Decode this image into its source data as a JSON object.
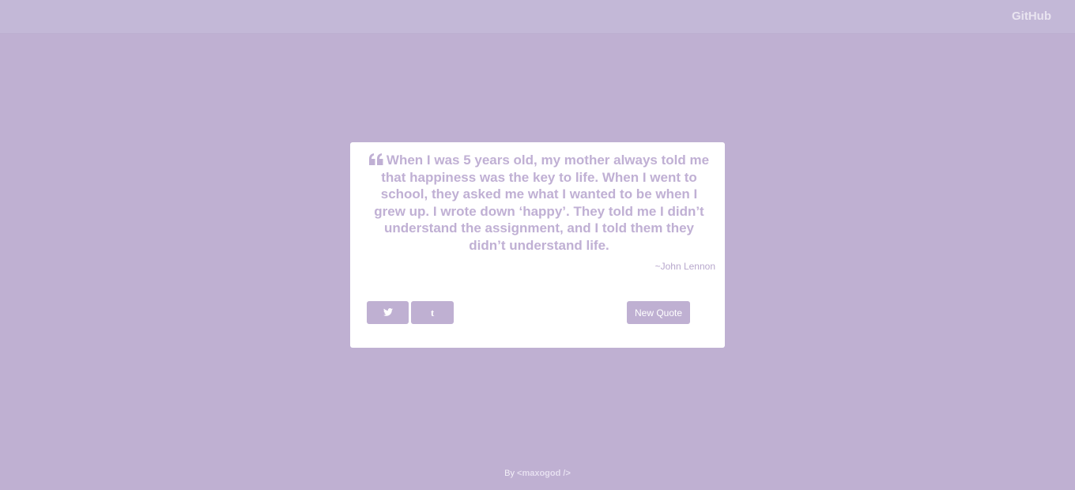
{
  "header": {
    "github_label": "GitHub"
  },
  "quote_box": {
    "quote_icon": "quote-left-icon",
    "text": "When I was 5 years old, my mother always told me that happiness was the key to life. When I went to school, they asked me what I wanted to be when I grew up. I wrote down ‘happy’. They told me I didn’t understand the assignment, and I told them they didn’t understand life.",
    "author": "~John Lennon",
    "twitter_icon": "twitter-icon",
    "tumblr_label": "t",
    "new_quote_label": "New Quote"
  },
  "footer": {
    "by_label": "By",
    "handle": "<maxogod />"
  },
  "colors": {
    "background": "#bfb0d2",
    "accent": "#c0b0d4",
    "card": "#ffffff"
  }
}
